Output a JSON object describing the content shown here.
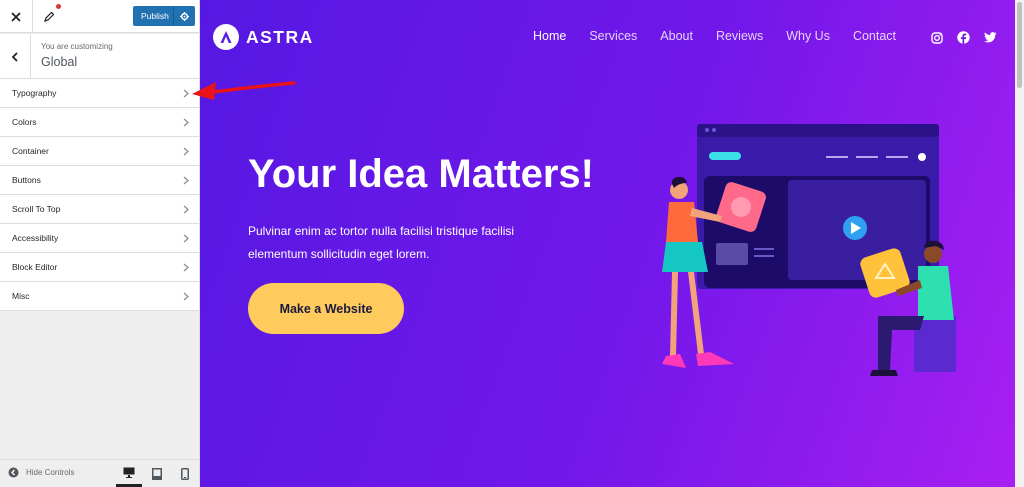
{
  "customizer": {
    "publish_label": "Publish",
    "customizing_label": "You are customizing",
    "section_title": "Global",
    "menu_items": [
      {
        "label": "Typography"
      },
      {
        "label": "Colors"
      },
      {
        "label": "Container"
      },
      {
        "label": "Buttons"
      },
      {
        "label": "Scroll To Top"
      },
      {
        "label": "Accessibility"
      },
      {
        "label": "Block Editor"
      },
      {
        "label": "Misc"
      }
    ],
    "hide_controls_label": "Hide Controls",
    "devices": [
      "desktop-icon",
      "tablet-icon",
      "mobile-icon"
    ],
    "active_device": "desktop"
  },
  "site": {
    "logo_text": "ASTRA",
    "nav": [
      "Home",
      "Services",
      "About",
      "Reviews",
      "Why Us",
      "Contact"
    ],
    "current_nav": "Home",
    "socials": [
      "instagram-icon",
      "facebook-icon",
      "twitter-icon"
    ],
    "hero_title": "Your Idea Matters!",
    "hero_text": "Pulvinar enim ac tortor nulla facilisi tristique facilisi elementum sollicitudin eget lorem.",
    "cta_label": "Make a Website"
  },
  "colors": {
    "accent": "#2271b1",
    "hero_gradient_start": "#5518e2",
    "hero_gradient_end": "#a81ff2",
    "cta": "#ffcb5c",
    "arrow": "#e8131b"
  }
}
